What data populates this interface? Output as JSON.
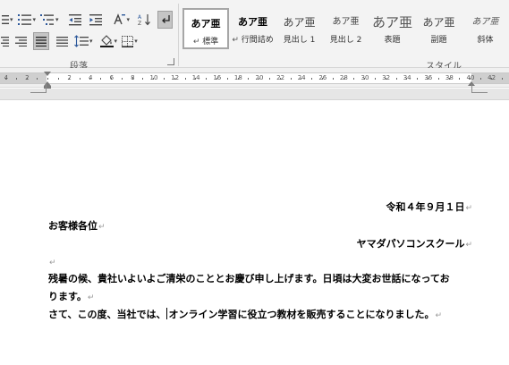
{
  "ribbon": {
    "paragraph_group": {
      "label": "段落",
      "row1": [
        {
          "name": "bullets-icon",
          "dropdown": true
        },
        {
          "name": "numbering-icon",
          "dropdown": true
        },
        {
          "name": "multilevel-list-icon",
          "dropdown": true
        },
        {
          "name": "decrease-indent-icon",
          "dropdown": false
        },
        {
          "name": "increase-indent-icon",
          "dropdown": false
        },
        {
          "name": "asian-layout-icon",
          "dropdown": true
        },
        {
          "name": "sort-icon",
          "dropdown": false
        },
        {
          "name": "show-hide-marks-icon",
          "dropdown": false,
          "pressed": true
        }
      ],
      "row2": [
        {
          "name": "align-center-icon"
        },
        {
          "name": "align-right-icon"
        },
        {
          "name": "justify-icon",
          "pressed": true
        },
        {
          "name": "distributed-icon"
        },
        {
          "name": "line-spacing-icon",
          "dropdown": true
        },
        {
          "name": "shading-icon",
          "dropdown": true
        },
        {
          "name": "borders-icon",
          "dropdown": true
        }
      ]
    },
    "styles_group": {
      "label": "スタイル",
      "items": [
        {
          "sample": "あア亜",
          "name": "標準",
          "mark": "↵",
          "selected": true,
          "variant": "bold"
        },
        {
          "sample": "あア亜",
          "name": "行間詰め",
          "mark": "↵",
          "selected": false,
          "variant": "bold"
        },
        {
          "sample": "あア亜",
          "name": "見出し 1",
          "mark": "",
          "selected": false,
          "variant": "light"
        },
        {
          "sample": "あア亜",
          "name": "見出し 2",
          "mark": "",
          "selected": false,
          "variant": "light-small"
        },
        {
          "sample": "あア亜",
          "name": "表題",
          "mark": "",
          "selected": false,
          "variant": "big"
        },
        {
          "sample": "あア亜",
          "name": "副題",
          "mark": "",
          "selected": false,
          "variant": "light"
        },
        {
          "sample": "あア亜",
          "name": "斜体",
          "mark": "",
          "selected": false,
          "variant": "italic"
        }
      ]
    }
  },
  "ruler": {
    "labels": [
      "4",
      "2",
      "2",
      "4",
      "6",
      "8",
      "10",
      "12",
      "14",
      "16",
      "18",
      "20",
      "22",
      "24",
      "26",
      "28",
      "30",
      "32",
      "34",
      "36",
      "38",
      "40",
      "42"
    ]
  },
  "document": {
    "paragraph_mark": "↵",
    "lines": [
      {
        "text": "令和４年９月１日",
        "align": "right"
      },
      {
        "text": "お客様各位",
        "align": "left"
      },
      {
        "text": "ヤマダパソコンスクール",
        "align": "right"
      },
      {
        "text": "",
        "align": "left"
      },
      {
        "text": "残暑の候、貴社いよいよご清栄のこととお慶び申し上げます。日頃は大変お世話になってお",
        "align": "left",
        "no_mark": true
      },
      {
        "text": "ります。",
        "align": "left"
      },
      {
        "text_before_caret": "さて、この度、当社では、",
        "text_after_caret": "オンライン学習に役立つ教材を販売することになりました。",
        "align": "left"
      }
    ]
  }
}
